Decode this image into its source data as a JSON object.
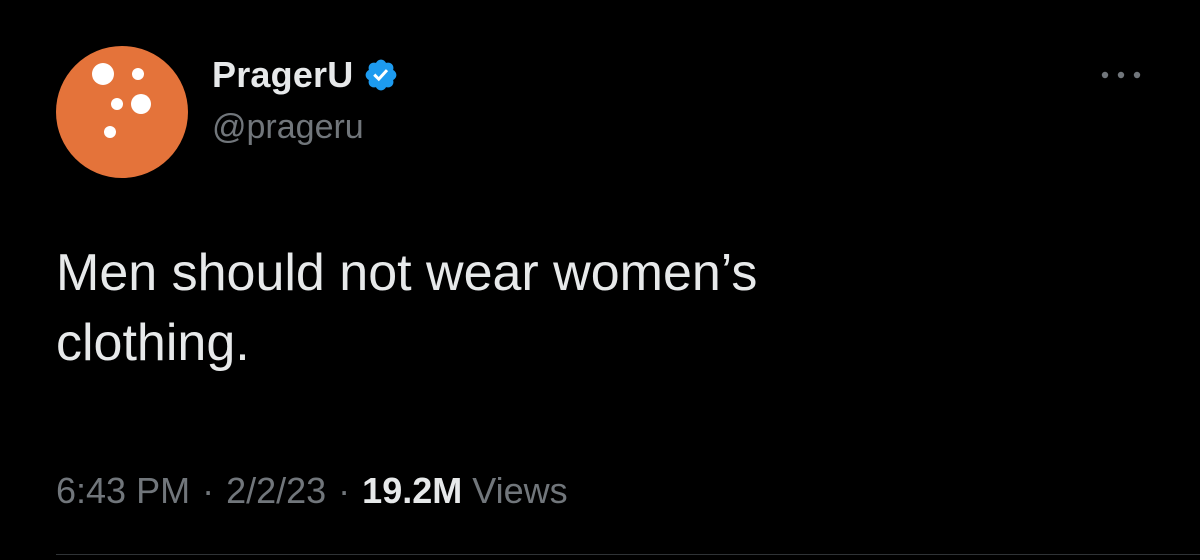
{
  "author": {
    "display_name": "PragerU",
    "handle": "@prageru",
    "avatar_color": "#e4733a",
    "verified": true,
    "verified_color": "#1d9bf0",
    "avatar_icon": "prageru-logo-dots"
  },
  "tweet": {
    "text": "Men should not wear women’s\nclothing.",
    "time": "6:43 PM",
    "date": "2/2/23",
    "separator": "·",
    "views_count": "19.2M",
    "views_label": "Views"
  },
  "header": {
    "more_icon": "more-horizontal-icon"
  },
  "colors": {
    "background": "#000000",
    "primary_text": "#e7e9ea",
    "secondary_text": "#71767b"
  }
}
